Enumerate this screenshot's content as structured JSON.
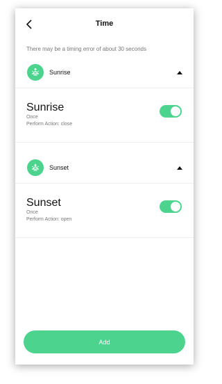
{
  "header": {
    "title": "Time"
  },
  "notice": "There may be a timing error of about 30 seconds",
  "groups": [
    {
      "title": "Sunrise",
      "icon": "sunrise-icon",
      "item": {
        "title": "Sunrise",
        "repeat": "Once",
        "action": "Perform Action: close",
        "enabled": true
      }
    },
    {
      "title": "Sunset",
      "icon": "sunset-icon",
      "item": {
        "title": "Sunset",
        "repeat": "Once",
        "action": "Perform Action: open",
        "enabled": true
      }
    }
  ],
  "footer": {
    "add_label": "Add"
  },
  "colors": {
    "accent": "#4cd38e"
  }
}
